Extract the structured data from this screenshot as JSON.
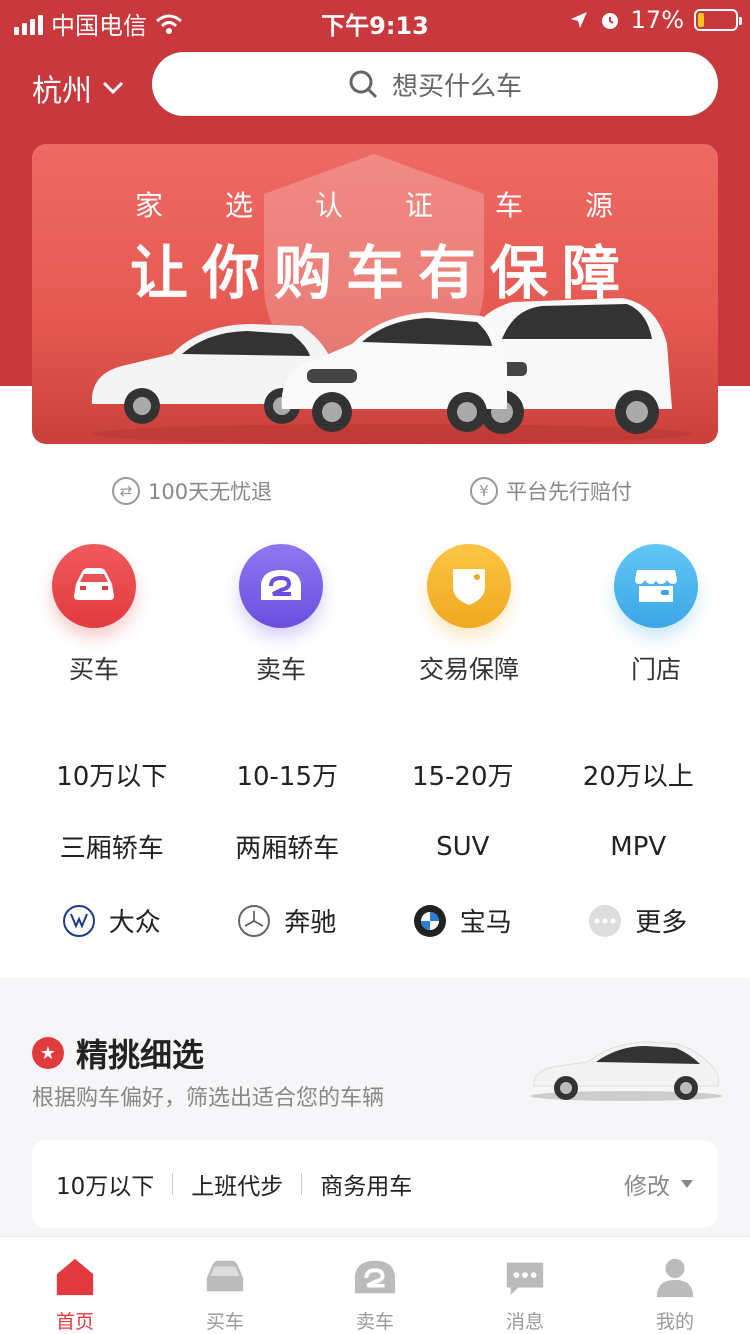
{
  "status": {
    "carrier": "中国电信",
    "time": "下午9:13",
    "battery": "17%"
  },
  "header": {
    "city": "杭州",
    "search_placeholder": "想买什么车"
  },
  "banner": {
    "subtitle": "家选认证车源",
    "title": "让你购车有保障"
  },
  "guarantees": [
    {
      "icon": "exchange-icon",
      "label": "100天无忧退"
    },
    {
      "icon": "yen-icon",
      "label": "平台先行赔付"
    }
  ],
  "quick": [
    {
      "icon": "car-icon",
      "label": "买车",
      "color": "#e8474b"
    },
    {
      "icon": "sell-car-icon",
      "label": "卖车",
      "color": "#7b61e8"
    },
    {
      "icon": "shield-icon",
      "label": "交易保障",
      "color": "#f5b52e"
    },
    {
      "icon": "store-icon",
      "label": "门店",
      "color": "#47b6ee"
    }
  ],
  "price_filters": [
    "10万以下",
    "10-15万",
    "15-20万",
    "20万以上"
  ],
  "type_filters": [
    "三厢轿车",
    "两厢轿车",
    "SUV",
    "MPV"
  ],
  "brand_filters": [
    {
      "icon": "volkswagen-logo-icon",
      "label": "大众"
    },
    {
      "icon": "mercedes-logo-icon",
      "label": "奔驰"
    },
    {
      "icon": "bmw-logo-icon",
      "label": "宝马"
    },
    {
      "icon": "more-dots-icon",
      "label": "更多"
    }
  ],
  "selection": {
    "title": "精挑细选",
    "description": "根据购车偏好，筛选出适合您的车辆",
    "prefs": [
      "10万以下",
      "上班代步",
      "商务用车"
    ],
    "modify": "修改"
  },
  "tabbar": [
    {
      "icon": "home-icon",
      "label": "首页",
      "active": true
    },
    {
      "icon": "car-icon",
      "label": "买车",
      "active": false
    },
    {
      "icon": "sell-car-icon",
      "label": "卖车",
      "active": false
    },
    {
      "icon": "message-icon",
      "label": "消息",
      "active": false
    },
    {
      "icon": "user-icon",
      "label": "我的",
      "active": false
    }
  ],
  "colors": {
    "brand_red": "#c8383c",
    "accent_red": "#e23b3f"
  }
}
